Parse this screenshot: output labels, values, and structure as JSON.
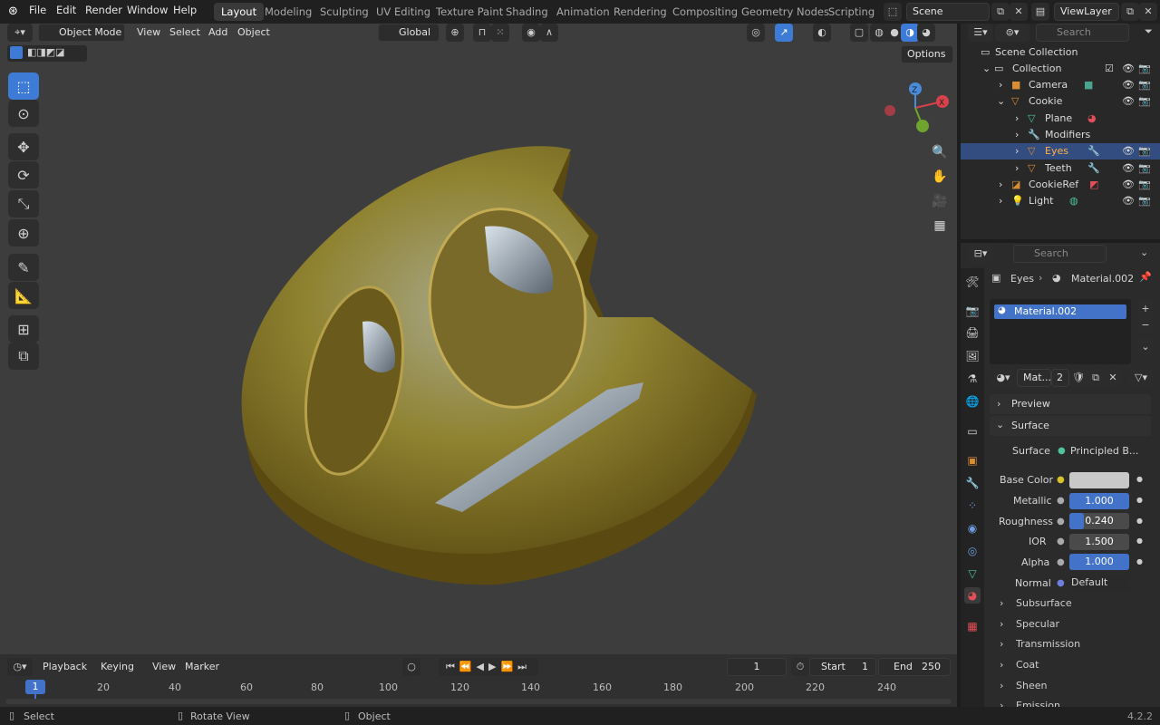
{
  "menu": [
    "File",
    "Edit",
    "Render",
    "Window",
    "Help"
  ],
  "workspaces": [
    "Layout",
    "Modeling",
    "Sculpting",
    "UV Editing",
    "Texture Paint",
    "Shading",
    "Animation",
    "Rendering",
    "Compositing",
    "Geometry Nodes",
    "Scripting"
  ],
  "scene": "Scene",
  "view_layer": "ViewLayer",
  "viewport": {
    "mode": "Object Mode",
    "menus": [
      "View",
      "Select",
      "Add",
      "Object"
    ],
    "orientation": "Global",
    "options": "Options",
    "gizmo": {
      "x": "X",
      "y": "Y",
      "z": "Z"
    }
  },
  "outliner": {
    "search_placeholder": "Search",
    "scene_collection": "Scene Collection",
    "rows": [
      {
        "label": "Collection"
      },
      {
        "label": "Camera"
      },
      {
        "label": "Cookie"
      },
      {
        "label": "Plane"
      },
      {
        "label": "Modifiers"
      },
      {
        "label": "Eyes"
      },
      {
        "label": "Teeth"
      },
      {
        "label": "CookieRef"
      },
      {
        "label": "Light"
      }
    ]
  },
  "properties": {
    "search_placeholder": "Search",
    "breadcrumb_object": "Eyes",
    "breadcrumb_material": "Material.002",
    "slot": "Material.002",
    "material_short": "Mat...",
    "user_count": "2",
    "panels": {
      "preview": "Preview",
      "surface": "Surface"
    },
    "surface_label": "Surface",
    "surface_value": "Principled B...",
    "fields": [
      {
        "label": "Base Color",
        "value": ""
      },
      {
        "label": "Metallic",
        "value": "1.000",
        "fill": 1.0
      },
      {
        "label": "Roughness",
        "value": "0.240",
        "fill": 0.24
      },
      {
        "label": "IOR",
        "value": "1.500",
        "fill": 0
      },
      {
        "label": "Alpha",
        "value": "1.000",
        "fill": 1.0
      },
      {
        "label": "Normal",
        "value": "Default"
      }
    ],
    "subpanels": [
      "Subsurface",
      "Specular",
      "Transmission",
      "Coat",
      "Sheen",
      "Emission"
    ]
  },
  "timeline": {
    "menus": [
      "Playback",
      "Keying",
      "View",
      "Marker"
    ],
    "current_frame": "1",
    "start_label": "Start",
    "start": "1",
    "end_label": "End",
    "end": "250",
    "ticks": [
      "1",
      "20",
      "40",
      "60",
      "80",
      "100",
      "120",
      "140",
      "160",
      "180",
      "200",
      "220",
      "240"
    ]
  },
  "status": {
    "select": "Select",
    "rotate": "Rotate View",
    "object": "Object",
    "version": "4.2.2"
  },
  "colors": {
    "accent": "#3d7bd6",
    "selected_row": "#334d80",
    "gold": "#a88d2c"
  }
}
